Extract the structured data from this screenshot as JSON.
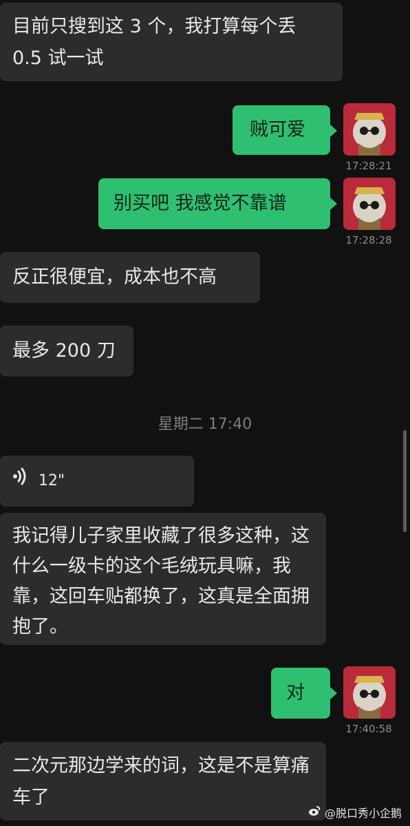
{
  "messages": {
    "m1": "目前只搜到这 3 个，我打算每个丢 0.5 试一试",
    "m2": "贼可爱",
    "m2_time": "17:28:21",
    "m3": "别买吧 我感觉不靠谱",
    "m3_time": "17:28:28",
    "m4": "反正很便宜，成本也不高",
    "m5": "最多 200 刀",
    "divider_time": "星期二 17:40",
    "voice_duration": "12\"",
    "m6": "我记得儿子家里收藏了很多这种，这什么一级卡的这个毛绒玩具嘛，我靠，这回车贴都换了，这真是全面拥抱了。",
    "m7": "对",
    "m7_time": "17:40:58",
    "m8": "二次元那边学来的词，这是不是算痛车了"
  },
  "watermark": "@脱口秀小企鹅",
  "colors": {
    "outgoing_bubble": "#2fbf71",
    "incoming_bubble": "#2c2c2c",
    "background": "#111111"
  }
}
